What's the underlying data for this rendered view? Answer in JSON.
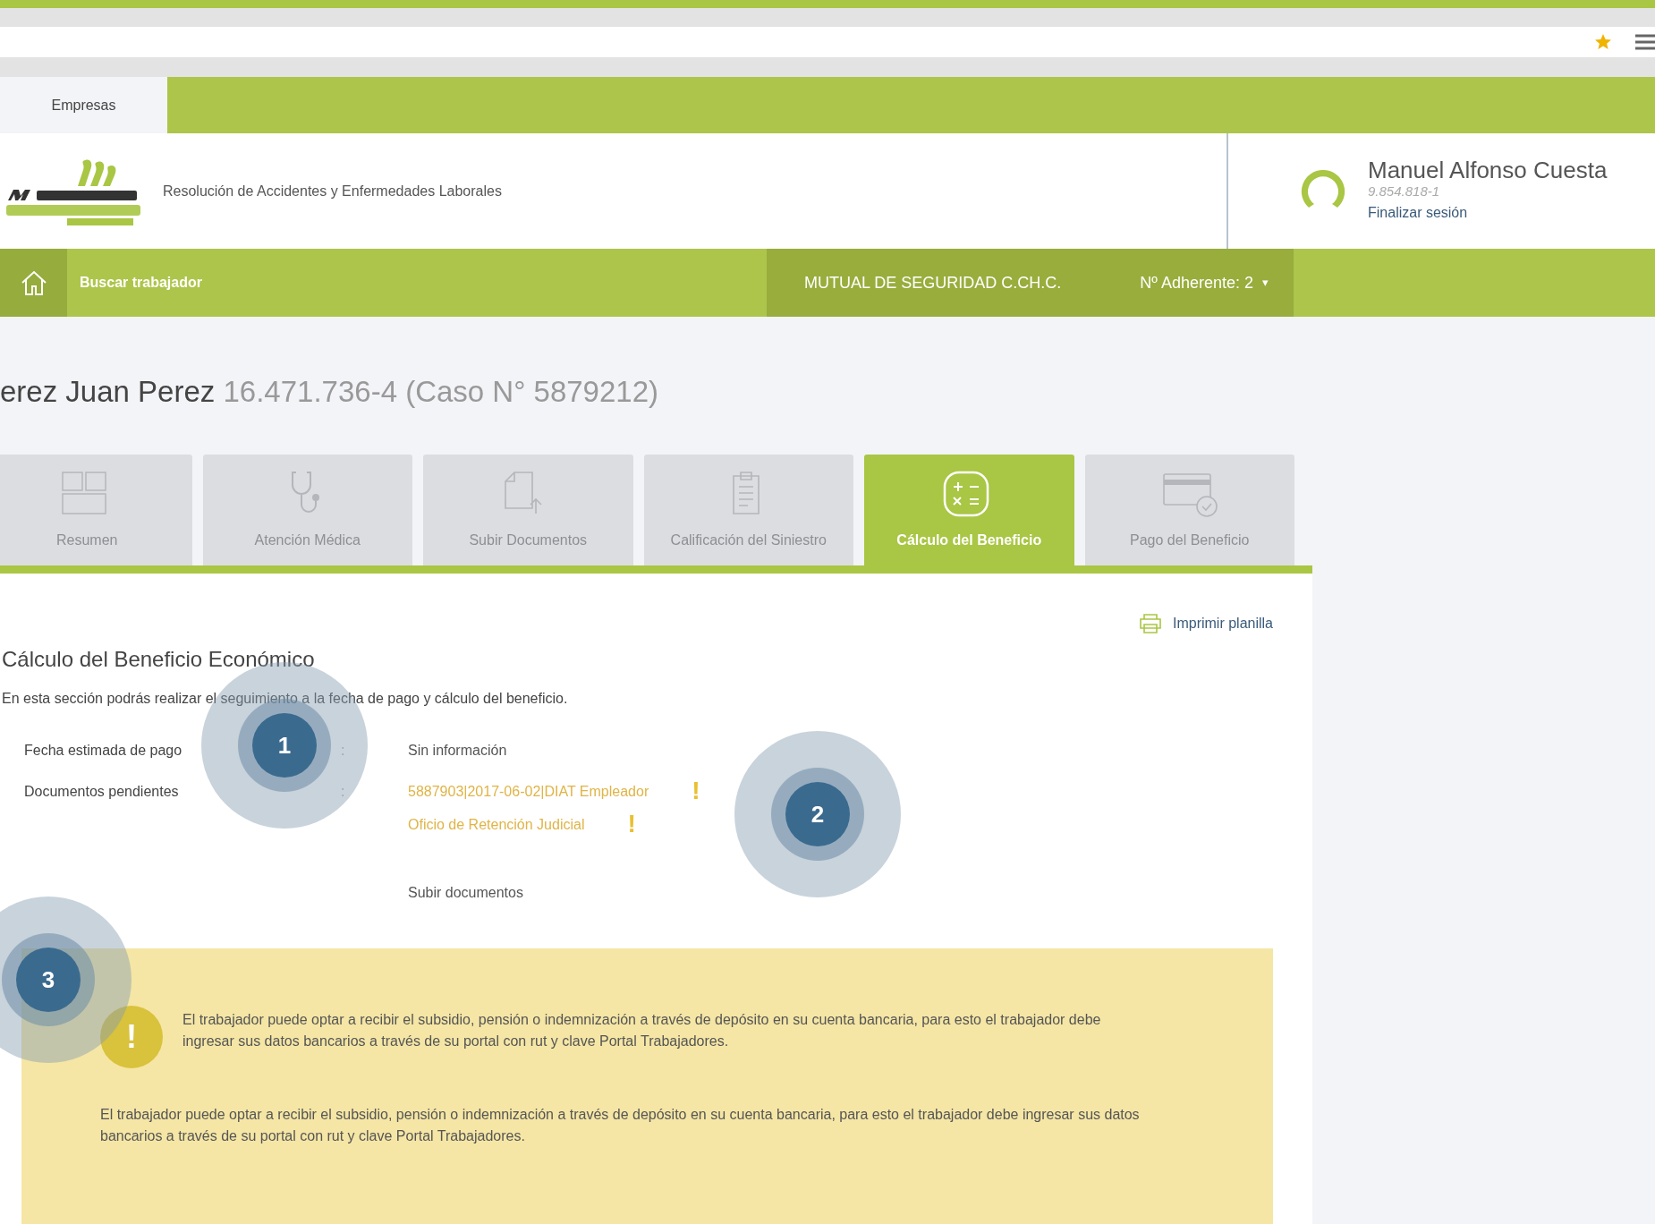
{
  "top_tabs": [
    {
      "label": "Empresas",
      "selected": true
    }
  ],
  "header": {
    "subtitle": "Resolución de Accidentes y Enfermedades Laborales",
    "user_name": "Manuel Alfonso Cuesta",
    "user_id": "9.854.818-1",
    "logout": "Finalizar sesión"
  },
  "navbar": {
    "search_link": "Buscar trabajador",
    "company": "MUTUAL DE SEGURIDAD C.CH.C.",
    "adherent": "Nº Adherente: 2",
    "caret": "▾"
  },
  "case_title": {
    "name": "erez Juan Perez",
    "detail": "16.471.736-4 (Caso N° 5879212)"
  },
  "step_tabs": [
    {
      "label": "Resumen",
      "kind": "grid",
      "selected": false
    },
    {
      "label": "Atención Médica",
      "kind": "stethoscope",
      "selected": false
    },
    {
      "label": "Subir Documentos",
      "kind": "upload",
      "selected": false
    },
    {
      "label": "Calificación del Siniestro",
      "kind": "clipboard",
      "selected": false
    },
    {
      "label": "Cálculo del Beneficio",
      "kind": "calculator",
      "selected": true
    },
    {
      "label": "Pago del Beneficio",
      "kind": "card",
      "selected": false
    }
  ],
  "section": {
    "title": "Cálculo del Beneficio Económico",
    "print_link": "Imprimir planilla",
    "description": "En esta sección podrás realizar el seguimiento a la fecha de pago y cálculo del beneficio.",
    "fields": [
      {
        "label": "Fecha estimada de pago",
        "separator": ":",
        "values": [
          {
            "text": "Sin información",
            "pending": false
          }
        ]
      },
      {
        "label": "Documentos pendientes",
        "separator": ":",
        "values": [
          {
            "text": "5887903|2017-06-02|DIAT Empleador",
            "pending": true,
            "mark": "!"
          },
          {
            "text": "Oficio de Retención Judicial",
            "pending": true,
            "mark": "!"
          }
        ]
      }
    ],
    "upload_link": "Subir documentos"
  },
  "alert": {
    "icon": "!",
    "text": "El trabajador puede optar a recibir el subsidio, pensión o indemnización a través de depósito en su cuenta bancaria, para esto el trabajador debe ingresar sus datos bancarios a través de su portal con rut y clave Portal Trabajadores.",
    "note": "El trabajador puede optar a recibir el subsidio, pensión o indemnización a través de depósito en su cuenta bancaria, para esto el trabajador debe ingresar sus datos bancarios a través de su portal con rut y clave Portal Trabajadores."
  },
  "annotations": [
    {
      "number": "1"
    },
    {
      "number": "2"
    },
    {
      "number": "3"
    }
  ]
}
